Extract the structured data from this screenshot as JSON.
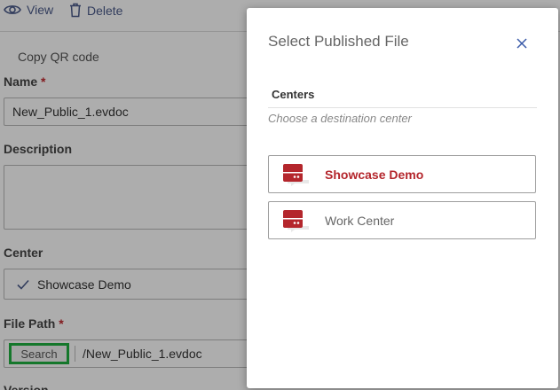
{
  "toolbar": {
    "view_label": "View",
    "delete_label": "Delete"
  },
  "copy_qr_label": "Copy QR code",
  "form": {
    "name_label": "Name",
    "name_value": "New_Public_1.evdoc",
    "description_label": "Description",
    "center_label": "Center",
    "center_value": "Showcase Demo",
    "file_path_label": "File Path",
    "search_label": "Search",
    "file_path_value": "/New_Public_1.evdoc",
    "version_label": "Version",
    "required_marker": "*"
  },
  "modal": {
    "title": "Select Published File",
    "section_title": "Centers",
    "section_hint": "Choose a destination center",
    "options": [
      {
        "label": "Showcase Demo",
        "selected": true
      },
      {
        "label": "Work Center",
        "selected": false
      }
    ]
  },
  "colors": {
    "accent": "#b4262c",
    "search_highlight": "#20b040",
    "link_icon": "#4a5a8a"
  }
}
